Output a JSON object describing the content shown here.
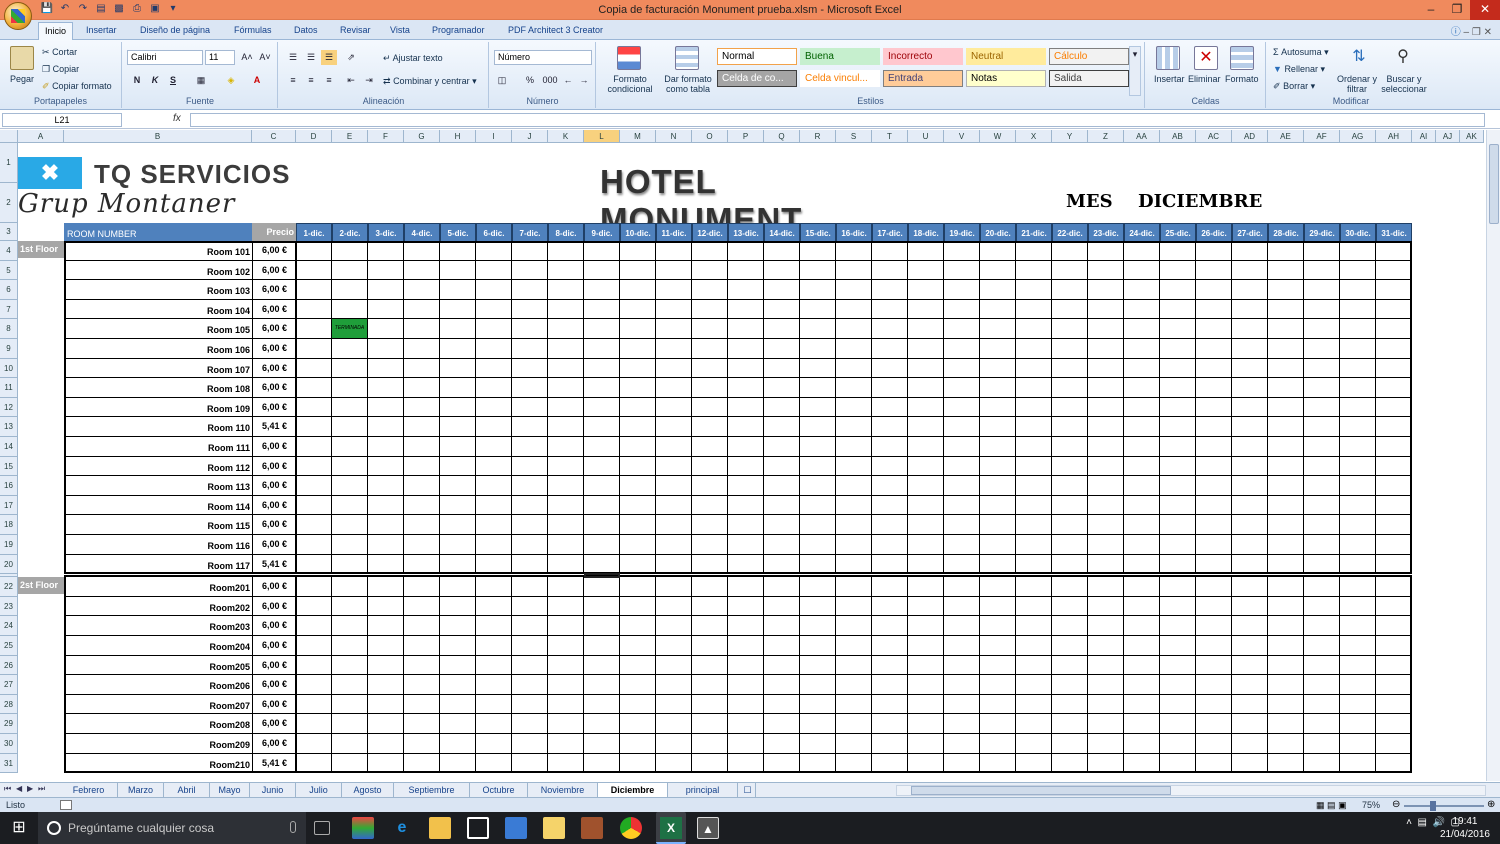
{
  "window": {
    "title": "Copia de facturación Monument prueba.xlsm - Microsoft Excel"
  },
  "ribbon_tabs": [
    "Inicio",
    "Insertar",
    "Diseño de página",
    "Fórmulas",
    "Datos",
    "Revisar",
    "Vista",
    "Programador",
    "PDF Architect 3 Creator"
  ],
  "ribbon": {
    "clipboard": {
      "paste": "Pegar",
      "cut": "Cortar",
      "copy": "Copiar",
      "format_painter": "Copiar formato",
      "label": "Portapapeles"
    },
    "font": {
      "name": "Calibri",
      "size": "11",
      "label": "Fuente",
      "bold": "N",
      "italic": "K",
      "underline": "S"
    },
    "alignment": {
      "wrap": "Ajustar texto",
      "merge": "Combinar y centrar",
      "label": "Alineación"
    },
    "number": {
      "format": "Número",
      "label": "Número",
      "percent": "%",
      "thousands": "000"
    },
    "styles": {
      "cond_format": "Formato condicional",
      "table_format": "Dar formato como tabla",
      "label": "Estilos",
      "cells": [
        {
          "text": "Normal",
          "bg": "#ffffff",
          "fg": "#000000",
          "border": "#f2a24b"
        },
        {
          "text": "Buena",
          "bg": "#c6efce",
          "fg": "#006100",
          "border": "#c6efce"
        },
        {
          "text": "Incorrecto",
          "bg": "#ffc7ce",
          "fg": "#9c0006",
          "border": "#ffc7ce"
        },
        {
          "text": "Neutral",
          "bg": "#ffeb9c",
          "fg": "#9c6500",
          "border": "#ffeb9c"
        },
        {
          "text": "Cálculo",
          "bg": "#f2f2f2",
          "fg": "#fa7d00",
          "border": "#7f7f7f"
        },
        {
          "text": "Celda de co...",
          "bg": "#a5a5a5",
          "fg": "#ffffff",
          "border": "#3f3f3f"
        },
        {
          "text": "Celda vincul...",
          "bg": "#ffffff",
          "fg": "#fa7d00",
          "border": "#ffffff"
        },
        {
          "text": "Entrada",
          "bg": "#ffcc99",
          "fg": "#3f3f76",
          "border": "#7f7f7f"
        },
        {
          "text": "Notas",
          "bg": "#ffffcc",
          "fg": "#000000",
          "border": "#b2b2b2"
        },
        {
          "text": "Salida",
          "bg": "#f2f2f2",
          "fg": "#3f3f3f",
          "border": "#3f3f3f"
        }
      ]
    },
    "cells": {
      "insert": "Insertar",
      "delete": "Eliminar",
      "format": "Formato",
      "label": "Celdas"
    },
    "editing": {
      "autosum": "Autosuma",
      "fill": "Rellenar",
      "clear": "Borrar",
      "sort": "Ordenar y filtrar",
      "find": "Buscar y seleccionar",
      "label": "Modificar"
    }
  },
  "formula_bar": {
    "name_box": "L21",
    "fx": "fx",
    "value": ""
  },
  "columns": [
    "A",
    "B",
    "C",
    "D",
    "E",
    "F",
    "G",
    "H",
    "I",
    "J",
    "K",
    "L",
    "M",
    "N",
    "O",
    "P",
    "Q",
    "R",
    "S",
    "T",
    "U",
    "V",
    "W",
    "X",
    "Y",
    "Z",
    "AA",
    "AB",
    "AC",
    "AD",
    "AE",
    "AF",
    "AG",
    "AH",
    "AI",
    "AJ",
    "AK"
  ],
  "selected_column": "L",
  "sheet": {
    "logo_top": "TQ SERVICIOS",
    "logo_script": "Grup Montaner",
    "title": "HOTEL MONUMENT",
    "mes_label": "MES",
    "mes_value": "DICIEMBRE",
    "room_header": "ROOM NUMBER",
    "price_header": "Precio",
    "days": [
      "1-dic.",
      "2-dic.",
      "3-dic.",
      "4-dic.",
      "5-dic.",
      "6-dic.",
      "7-dic.",
      "8-dic.",
      "9-dic.",
      "10-dic.",
      "11-dic.",
      "12-dic.",
      "13-dic.",
      "14-dic.",
      "15-dic.",
      "16-dic.",
      "17-dic.",
      "18-dic.",
      "19-dic.",
      "20-dic.",
      "21-dic.",
      "22-dic.",
      "23-dic.",
      "24-dic.",
      "25-dic.",
      "26-dic.",
      "27-dic.",
      "28-dic.",
      "29-dic.",
      "30-dic.",
      "31-dic."
    ],
    "done_marker": "TERMINADA",
    "floors": [
      {
        "label": "1st Floor",
        "rows": [
          {
            "row": "4",
            "room": "Room 101",
            "price": "6,00 €"
          },
          {
            "row": "5",
            "room": "Room 102",
            "price": "6,00 €"
          },
          {
            "row": "6",
            "room": "Room 103",
            "price": "6,00 €"
          },
          {
            "row": "7",
            "room": "Room 104",
            "price": "6,00 €"
          },
          {
            "row": "8",
            "room": "Room 105",
            "price": "6,00 €",
            "done_day": "2-dic."
          },
          {
            "row": "9",
            "room": "Room 106",
            "price": "6,00 €"
          },
          {
            "row": "10",
            "room": "Room 107",
            "price": "6,00 €"
          },
          {
            "row": "11",
            "room": "Room 108",
            "price": "6,00 €"
          },
          {
            "row": "12",
            "room": "Room 109",
            "price": "6,00 €"
          },
          {
            "row": "13",
            "room": "Room 110",
            "price": "5,41 €"
          },
          {
            "row": "14",
            "room": "Room 111",
            "price": "6,00 €"
          },
          {
            "row": "15",
            "room": "Room 112",
            "price": "6,00 €"
          },
          {
            "row": "16",
            "room": "Room 113",
            "price": "6,00 €"
          },
          {
            "row": "17",
            "room": "Room 114",
            "price": "6,00 €"
          },
          {
            "row": "18",
            "room": "Room 115",
            "price": "6,00 €"
          },
          {
            "row": "19",
            "room": "Room 116",
            "price": "6,00 €"
          },
          {
            "row": "20",
            "room": "Room 117",
            "price": "5,41 €"
          }
        ]
      },
      {
        "label": "2st Floor",
        "rows": [
          {
            "row": "22",
            "room": "Room201",
            "price": "6,00 €"
          },
          {
            "row": "23",
            "room": "Room202",
            "price": "6,00 €"
          },
          {
            "row": "24",
            "room": "Room203",
            "price": "6,00 €"
          },
          {
            "row": "25",
            "room": "Room204",
            "price": "6,00 €"
          },
          {
            "row": "26",
            "room": "Room205",
            "price": "6,00 €"
          },
          {
            "row": "27",
            "room": "Room206",
            "price": "6,00 €"
          },
          {
            "row": "28",
            "room": "Room207",
            "price": "6,00 €"
          },
          {
            "row": "29",
            "room": "Room208",
            "price": "6,00 €"
          },
          {
            "row": "30",
            "room": "Room209",
            "price": "6,00 €"
          },
          {
            "row": "31",
            "room": "Room210",
            "price": "5,41 €"
          }
        ]
      }
    ]
  },
  "sheet_tabs": [
    "Febrero",
    "Marzo",
    "Abril",
    "Mayo",
    "Junio",
    "Julio",
    "Agosto",
    "Septiembre",
    "Octubre",
    "Noviembre",
    "Diciembre",
    "principal"
  ],
  "active_sheet": "Diciembre",
  "status": {
    "text": "Listo",
    "zoom": "75%"
  },
  "taskbar": {
    "search_placeholder": "Pregúntame cualquier cosa",
    "time": "19:41",
    "date": "21/04/2016"
  }
}
